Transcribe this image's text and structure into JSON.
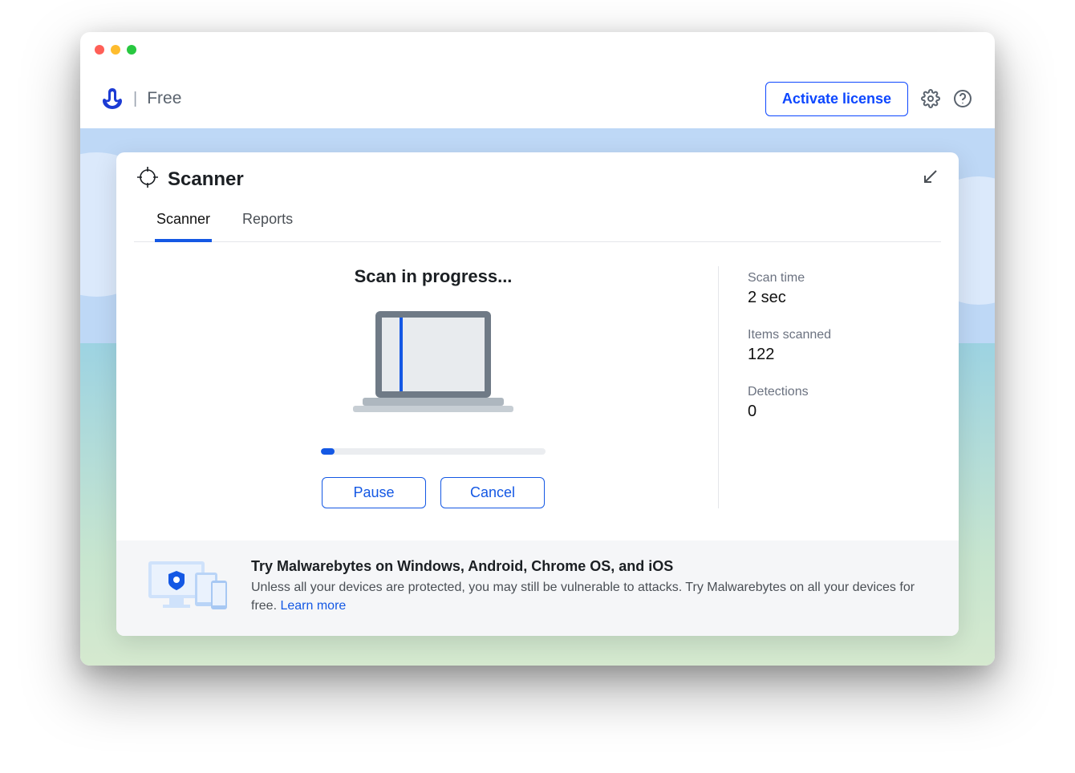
{
  "header": {
    "plan": "Free",
    "activate_label": "Activate license"
  },
  "card": {
    "title": "Scanner",
    "tabs": {
      "scanner": "Scanner",
      "reports": "Reports"
    }
  },
  "scan": {
    "status_title": "Scan in progress...",
    "pause_label": "Pause",
    "cancel_label": "Cancel",
    "progress_percent": 6
  },
  "stats": {
    "time_label": "Scan time",
    "time_value": "2 sec",
    "items_label": "Items scanned",
    "items_value": "122",
    "detections_label": "Detections",
    "detections_value": "0"
  },
  "promo": {
    "title": "Try Malwarebytes on Windows, Android, Chrome OS, and iOS",
    "text": "Unless all your devices are protected, you may still be vulnerable to attacks. Try Malwarebytes on all your devices for free. ",
    "link": "Learn more"
  }
}
